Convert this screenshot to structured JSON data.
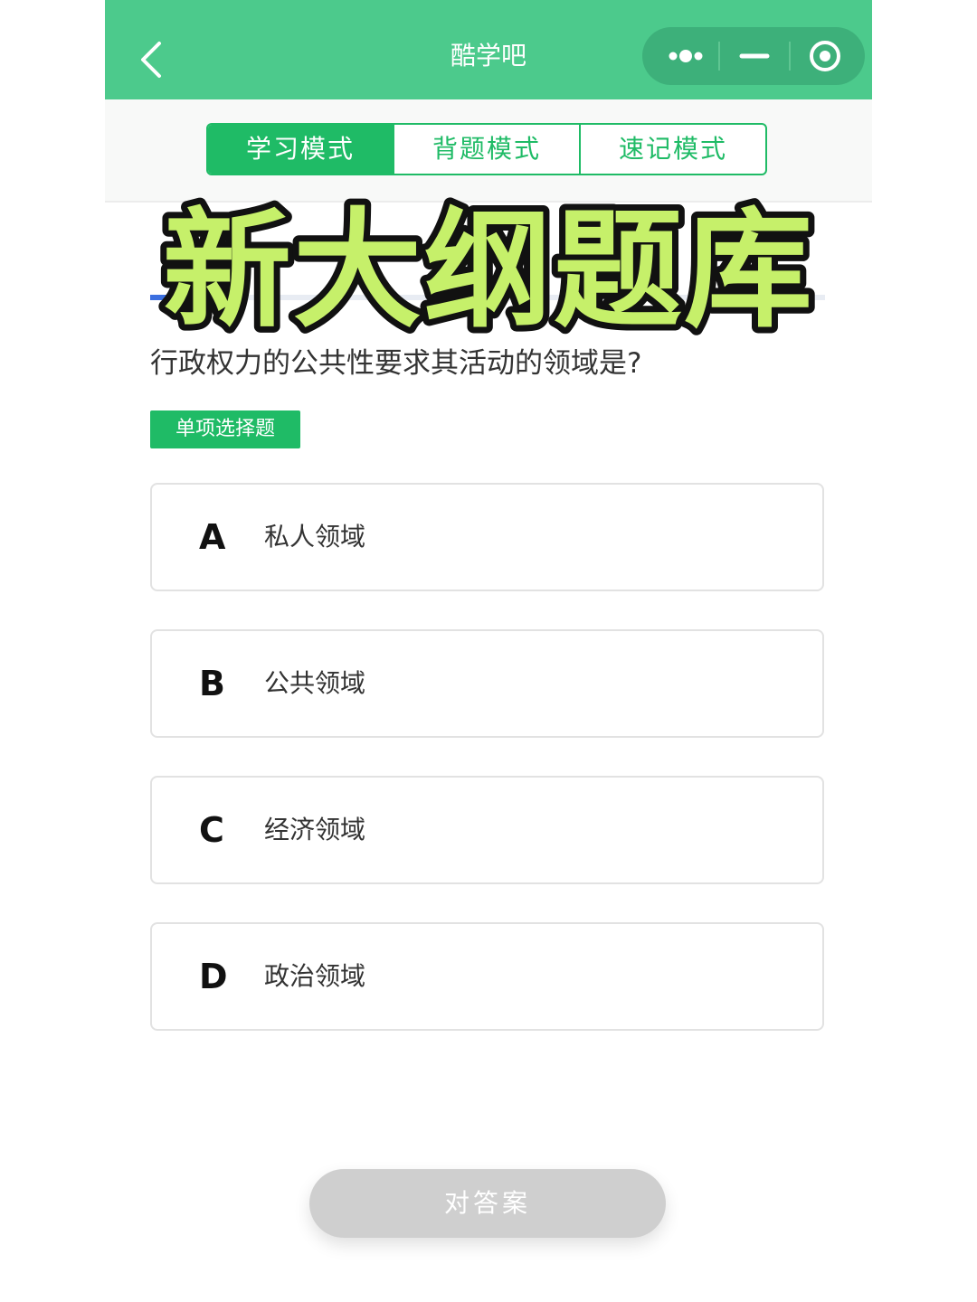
{
  "navbar": {
    "title": "酷学吧",
    "back_icon": "chevron-left-icon",
    "more_icon": "more-dots-icon",
    "minimize_icon": "minimize-icon",
    "close_icon": "target-circle-icon"
  },
  "tabs": [
    {
      "label": "学习模式",
      "active": true
    },
    {
      "label": "背题模式",
      "active": false
    },
    {
      "label": "速记模式",
      "active": false
    }
  ],
  "overlay_headline": "新大纲题库",
  "question": {
    "text": "行政权力的公共性要求其活动的领域是?",
    "type_label": "单项选择题"
  },
  "options": [
    {
      "letter": "A",
      "text": "私人领域"
    },
    {
      "letter": "B",
      "text": "公共领域"
    },
    {
      "letter": "C",
      "text": "经济领域"
    },
    {
      "letter": "D",
      "text": "政治领域"
    }
  ],
  "check_button_label": "对答案",
  "colors": {
    "navbar": "#4cca8c",
    "accent": "#1fbb66",
    "headline_fill": "#c6f06a",
    "headline_stroke": "#111111",
    "button_disabled": "#cfcfcf"
  }
}
